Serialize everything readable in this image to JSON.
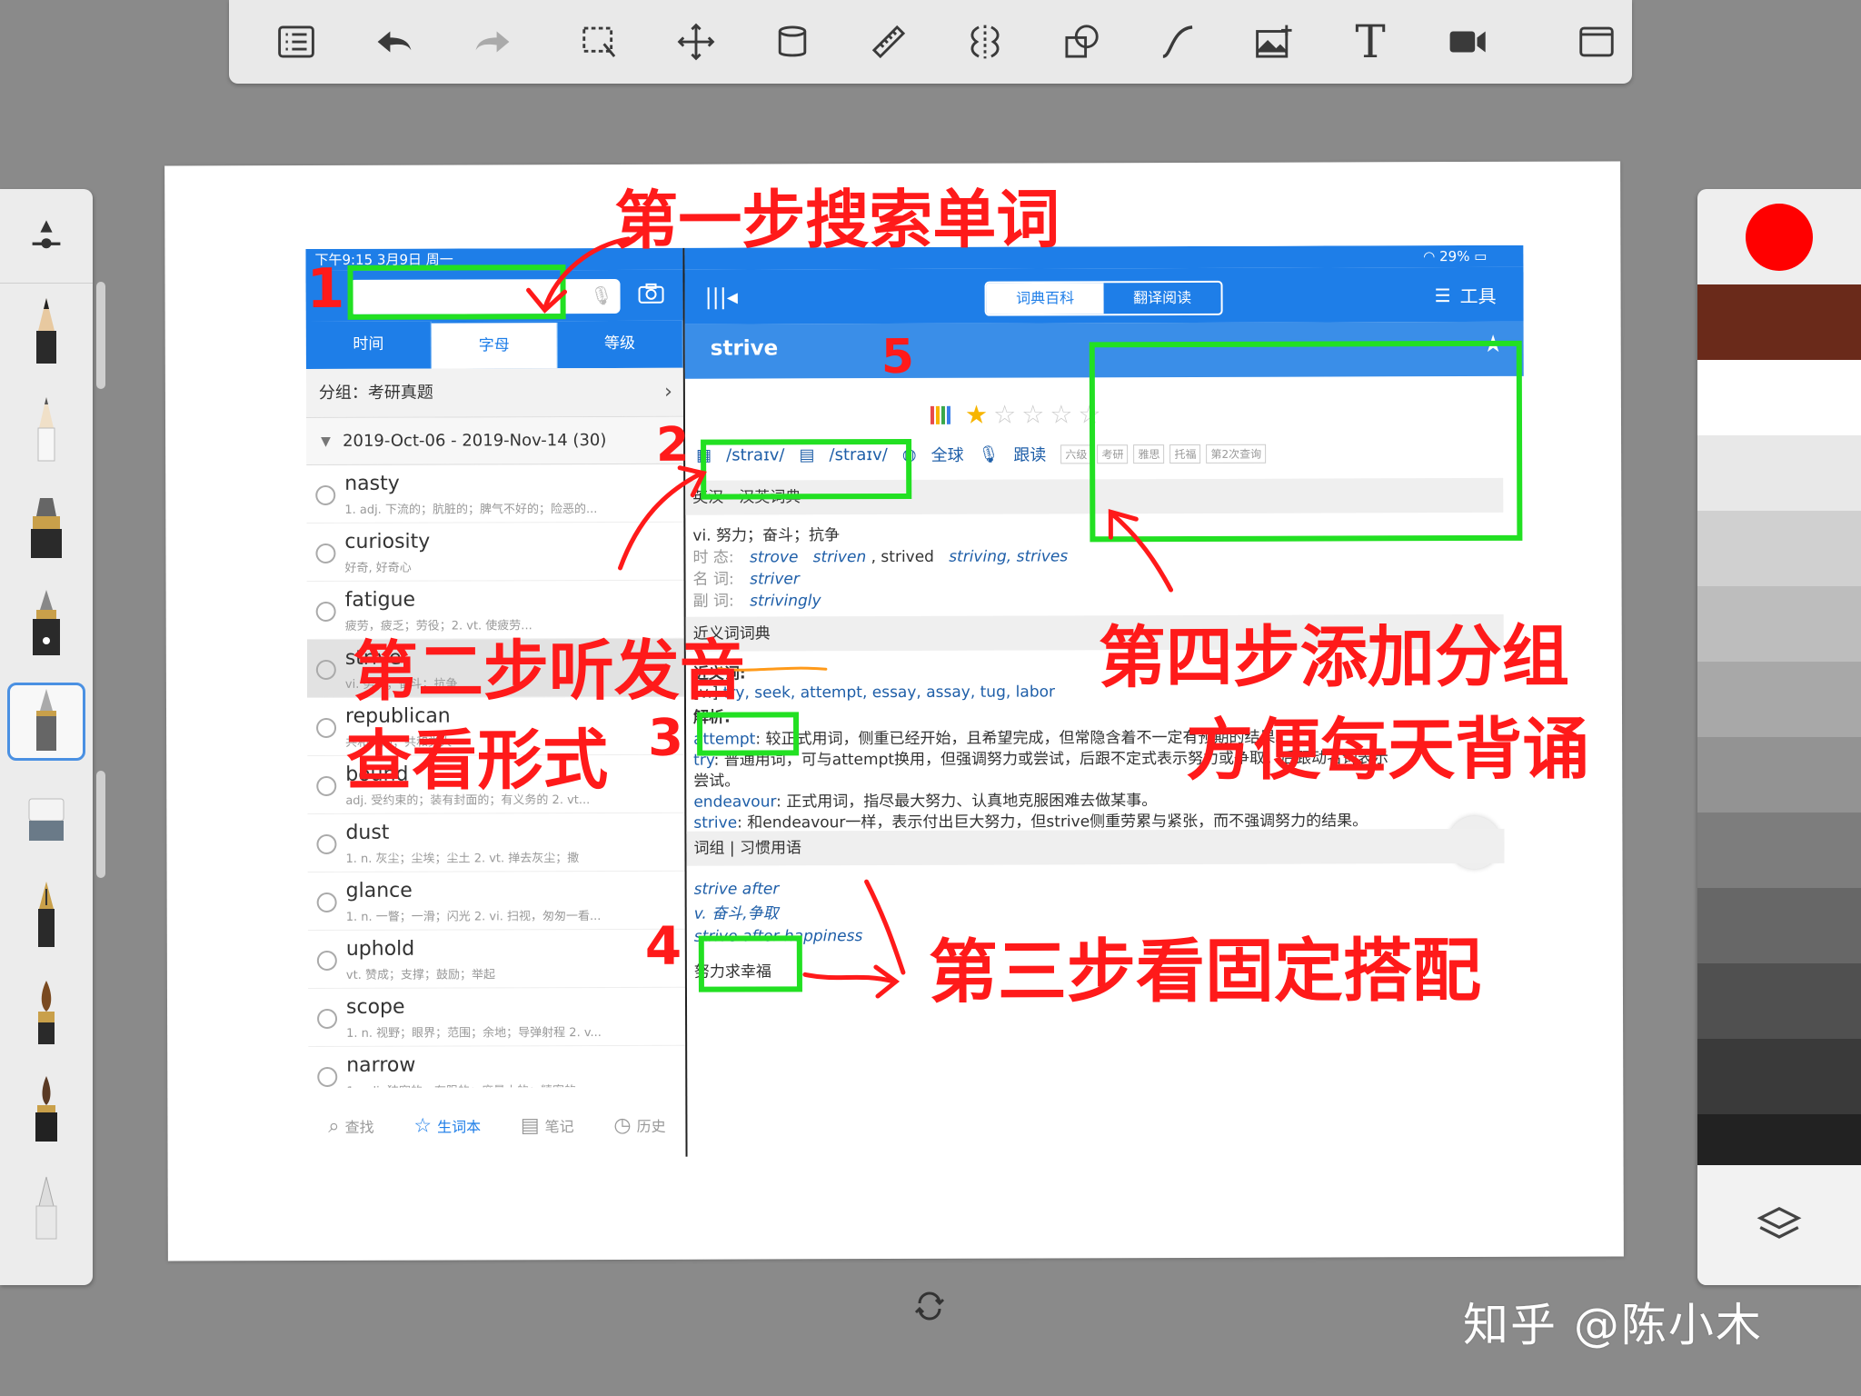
{
  "toolbar": {
    "items": [
      "list-icon",
      "undo-icon",
      "redo-icon",
      "selection-icon",
      "move-icon",
      "fill-bucket-icon",
      "ruler-icon",
      "symmetry-icon",
      "shapes-icon",
      "curve-icon",
      "insert-image-icon",
      "text-icon",
      "video-icon",
      "fullscreen-icon"
    ],
    "text_glyph": "T"
  },
  "brushes": [
    "brush-size-icon",
    "pencil-icon",
    "ink-pen-icon",
    "marker-icon",
    "fountain-pen-icon",
    "technical-pen-icon",
    "eraser-icon",
    "calligraphy-pen-icon",
    "paint-brush-icon",
    "felt-brush-icon",
    "airbrush-icon"
  ],
  "colors": {
    "selected": "#ff0000",
    "swatches": [
      "#6a2a1a",
      "#ffffff",
      "#e8e8e8",
      "#d0d0d0",
      "#bdbdbd",
      "#a8a8a8",
      "#939393",
      "#7d7d7d",
      "#676767",
      "#505050",
      "#3a3a3a",
      "#222222"
    ]
  },
  "app": {
    "status_left": "下午9:15  3月9日 周一",
    "status_right": "29%",
    "left_tabs": [
      "时间",
      "字母",
      "等级"
    ],
    "active_left_tab": 1,
    "group_label": "分组：考研真题",
    "date_range": "2019-Oct-06 - 2019-Nov-14 (30)",
    "words": [
      {
        "word": "nasty",
        "def": "1. adj. 下流的；肮脏的；脾气不好的；险恶的..."
      },
      {
        "word": "curiosity",
        "def": "好奇, 好奇心"
      },
      {
        "word": "fatigue",
        "def": "疲劳，疲乏；劳役；2. vt. 使疲劳..."
      },
      {
        "word": "strive",
        "def": "vi. 努力；奋斗；抗争"
      },
      {
        "word": "republican",
        "def": "共和党的；共和党人"
      },
      {
        "word": "bound",
        "def": "adj. 受约束的；装有封面的；有义务的 2. vt..."
      },
      {
        "word": "dust",
        "def": "1. n. 灰尘；尘埃；尘土 2. vt. 掸去灰尘；撒"
      },
      {
        "word": "glance",
        "def": "1. n. 一瞥；一滑；闪光 2. vi. 扫视，匆匆一看..."
      },
      {
        "word": "uphold",
        "def": "vt. 赞成；支撑；鼓励；举起"
      },
      {
        "word": "scope",
        "def": "1. n. 视野；眼界；范围；余地；导弹射程 2. v..."
      },
      {
        "word": "narrow",
        "def": "1. adj. 狭窄的，有限的；度量小的；精密的..."
      }
    ],
    "active_word_index": 3,
    "bottom_nav": [
      "查找",
      "生词本",
      "笔记",
      "历史"
    ],
    "active_nav": 1,
    "segments": [
      "词典百科",
      "翻译阅读"
    ],
    "tools_label": "工具",
    "headword": "strive",
    "pron_uk": "/straɪv/",
    "pron_us": "/straɪv/",
    "pron_global": "全球",
    "follow_read": "跟读",
    "tags": [
      "六级",
      "考研",
      "雅思",
      "托福",
      "第2次查询"
    ],
    "section_en_zh": "英汉－汉英词典",
    "pos_def": "vi. 努力；奋斗；抗争",
    "tense_label": "时 态:",
    "tense_values": [
      "strove",
      "striven",
      ", strived",
      "striving, strives"
    ],
    "noun_label": "名 词:",
    "noun_value": "striver",
    "adv_label": "副 词:",
    "adv_value": "strivingly",
    "section_syn": "近义词词典",
    "syn_label": "近义词:",
    "syn_prefix": "[v.]",
    "syn_words": "try, seek, attempt, essay, assay, tug, labor",
    "analysis_label": "解析:",
    "analysis": [
      {
        "term": "attempt",
        "text": ": 较正式用词，侧重已经开始，且希望完成，但常隐含着不一定有预期的结果。"
      },
      {
        "term": "try",
        "text": ": 普通用词，可与attempt换用，但强调努力或尝试，后跟不定式表示努力或争取；后跟动名词表示"
      },
      {
        "term": "",
        "text": "尝试。"
      },
      {
        "term": "endeavour",
        "text": ": 正式用词，指尽最大努力、认真地克服困难去做某事。"
      },
      {
        "term": "strive",
        "text": ": 和endeavour一样，表示付出巨大努力，但strive侧重劳累与紧张，而不强调努力的结果。"
      }
    ],
    "section_phrase": "词组 | 习惯用语",
    "phrase1": "strive after",
    "phrase1_def": "v. 奋斗,争取",
    "phrase2": "strive after happiness",
    "phrase2_def": "努力求幸福"
  },
  "annotations": {
    "step1": "第一步搜索单词",
    "step2": "第二步听发音",
    "step2b": "查看形式",
    "step3": "第三步看固定搭配",
    "step4a": "第四步添加分组",
    "step4b": "方便每天背诵",
    "num1": "1",
    "num2": "2",
    "num3": "3",
    "num4": "4",
    "num5": "5"
  },
  "watermark": "知乎 @陈小木"
}
